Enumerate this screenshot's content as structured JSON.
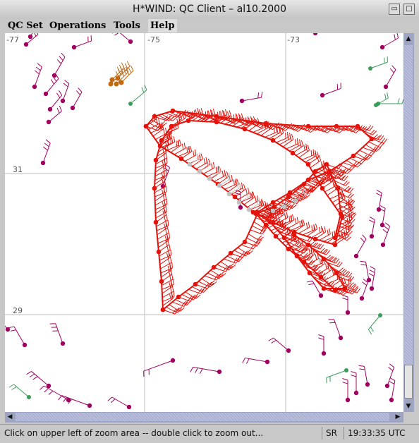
{
  "window": {
    "title": "H*WIND: QC Client – al10.2000"
  },
  "menubar": {
    "items": [
      "QC Set",
      "Operations",
      "Tools",
      "Help"
    ]
  },
  "map": {
    "lon_labels": [
      "-77",
      "-75",
      "-73"
    ],
    "lat_labels": [
      "31",
      "29"
    ],
    "track_color": "#e3120b",
    "station_color": "#a0005f",
    "accent_green": "#3a9d5a",
    "accent_orange": "#c06a10",
    "flagged_gray": "#c0c0c0"
  },
  "status": {
    "message": "Click on upper left of zoom area -- double click to zoom out...",
    "mode": "SR",
    "time": "19:33:35 UTC"
  }
}
